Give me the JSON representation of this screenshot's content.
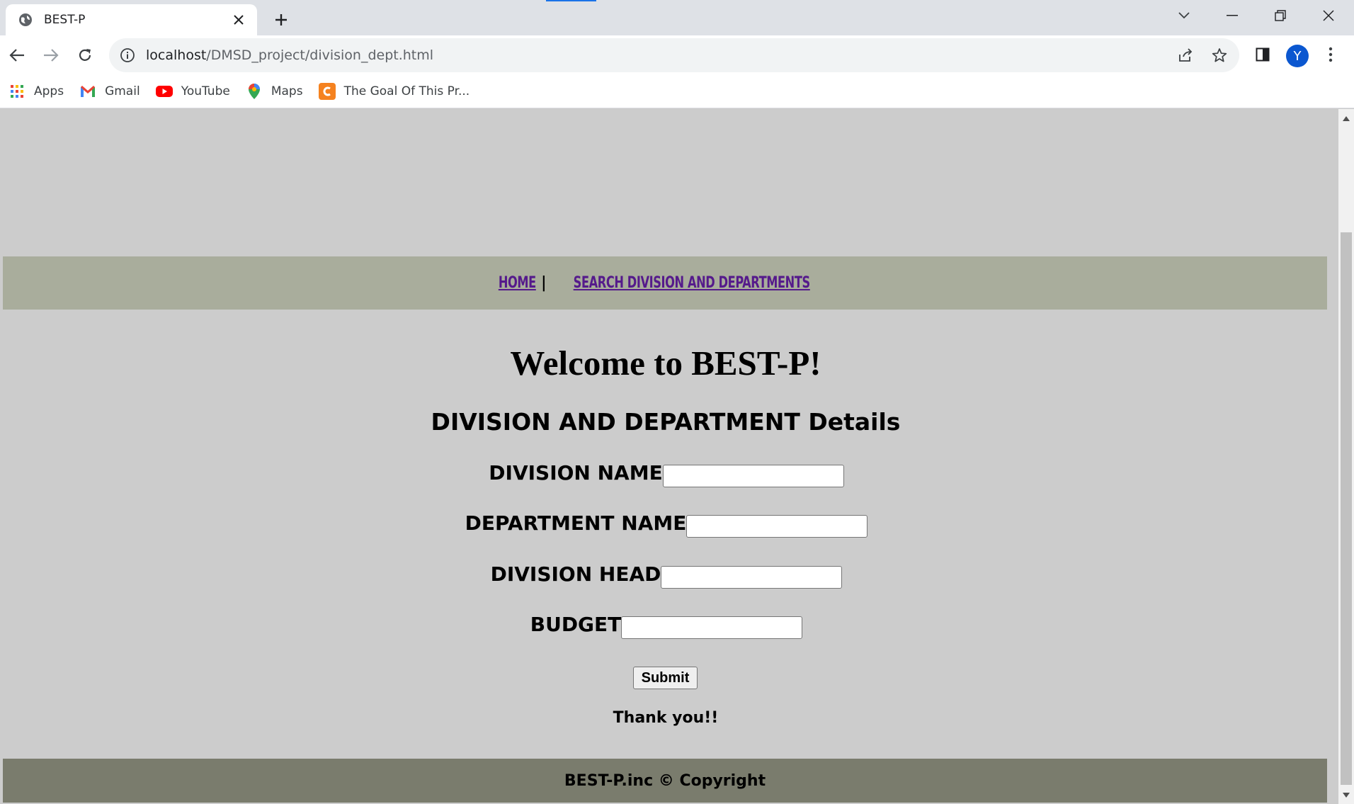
{
  "browser": {
    "tab_title": "BEST-P",
    "url_host": "localhost",
    "url_path": "/DMSD_project/division_dept.html",
    "avatar_letter": "Y",
    "bookmarks": [
      {
        "label": "Apps",
        "icon": "apps-grid-icon"
      },
      {
        "label": "Gmail",
        "icon": "gmail-icon"
      },
      {
        "label": "YouTube",
        "icon": "youtube-icon"
      },
      {
        "label": "Maps",
        "icon": "maps-pin-icon"
      },
      {
        "label": "The Goal Of This Pr...",
        "icon": "c-logo-icon"
      }
    ]
  },
  "page": {
    "nav": {
      "home": "HOME",
      "separator": "|",
      "search": "SEARCH DIVISION AND DEPARTMENTS"
    },
    "welcome": "Welcome to BEST-P!",
    "subheading": "DIVISION AND DEPARTMENT Details",
    "form": {
      "division_name": "DIVISION NAME",
      "department_name": "DEPARTMENT NAME",
      "division_head": "DIVISION HEAD",
      "budget": "BUDGET",
      "submit": "Submit"
    },
    "thanks": "Thank you!!",
    "footer": "BEST-P.inc © Copyright"
  },
  "colors": {
    "page_bg": "#cccccc",
    "nav_bg": "#a9ad9c",
    "footer_bg": "#7a7c6d",
    "link": "#551a8b"
  }
}
